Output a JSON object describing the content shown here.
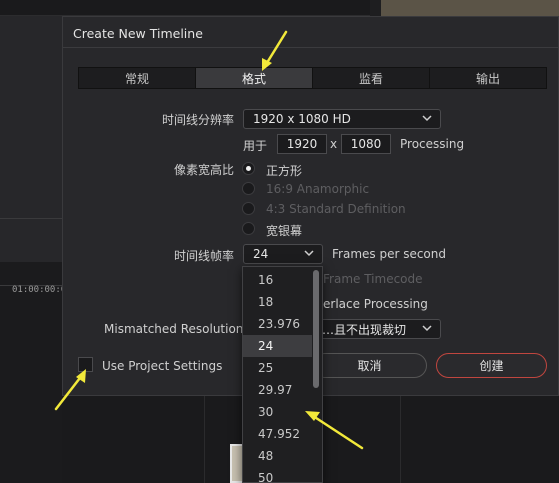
{
  "dialog": {
    "title": "Create New Timeline"
  },
  "tabs": [
    {
      "label": "常规",
      "active": false
    },
    {
      "label": "格式",
      "active": true
    },
    {
      "label": "监看",
      "active": false
    },
    {
      "label": "输出",
      "active": false
    }
  ],
  "resolution": {
    "label": "时间线分辨率",
    "value": "1920 x 1080 HD",
    "for_label": "用于",
    "width": "1920",
    "times": "x",
    "height": "1080",
    "processing": "Processing"
  },
  "pixel_aspect": {
    "label": "像素宽高比",
    "options": [
      {
        "label": "正方形",
        "selected": true,
        "disabled": false
      },
      {
        "label": "16:9 Anamorphic",
        "selected": false,
        "disabled": true
      },
      {
        "label": "4:3 Standard Definition",
        "selected": false,
        "disabled": true
      },
      {
        "label": "宽银幕",
        "selected": false,
        "disabled": false
      }
    ]
  },
  "frame_rate": {
    "label": "时间线帧率",
    "value": "24",
    "suffix": "Frames per second",
    "options": [
      "16",
      "18",
      "23.976",
      "24",
      "25",
      "29.97",
      "30",
      "47.952",
      "48",
      "50"
    ],
    "selected": "24"
  },
  "hidden_rows": {
    "timecode_partial": "Frame Timecode",
    "interlace_partial": "erlace Processing"
  },
  "mismatched": {
    "label": "Mismatched Resolution",
    "value": "…且不出现裁切"
  },
  "use_project_settings": {
    "label": "Use Project Settings",
    "checked": false
  },
  "buttons": {
    "cancel": "取消",
    "create": "创建"
  },
  "background": {
    "timecode": "01:00:00:0"
  },
  "colors": {
    "accent_red": "#c0463f",
    "annotation_arrow": "#f2e93a"
  }
}
